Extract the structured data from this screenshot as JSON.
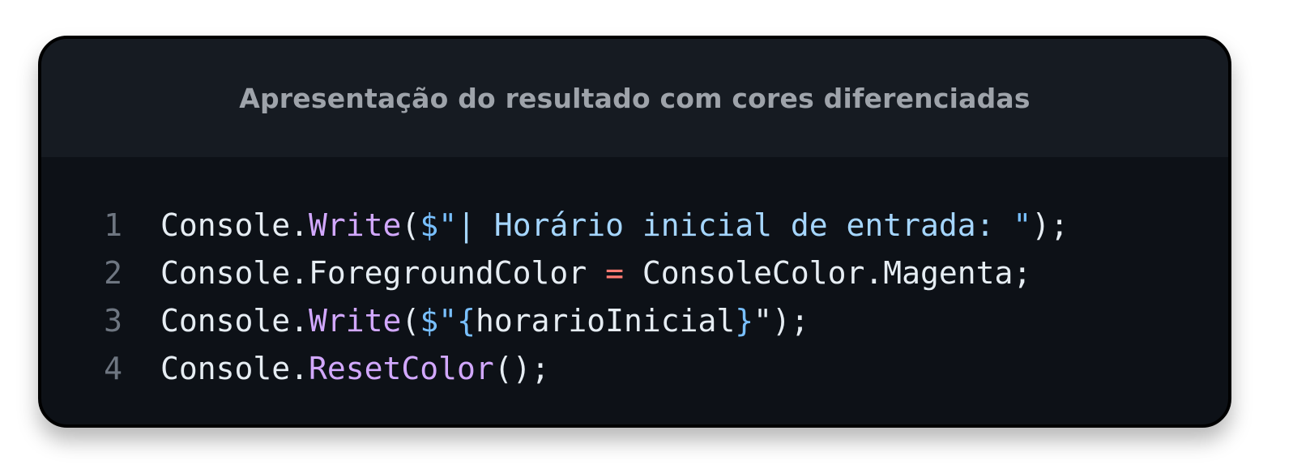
{
  "title": "Apresentação do resultado com cores diferenciadas",
  "colors": {
    "card_background": "#0d1117",
    "header_background": "#161b22",
    "title_text": "#9ea3aa",
    "line_number": "#6e7681",
    "default_text": "#e6edf3",
    "method": "#d2a8ff",
    "string": "#a5d6ff",
    "punctuation": "#79c0ff",
    "operator": "#ff7b72"
  },
  "code": {
    "language": "csharp",
    "lines": [
      {
        "number": "1",
        "tokens": [
          {
            "text": "Console.",
            "kind": "default"
          },
          {
            "text": "Write",
            "kind": "method"
          },
          {
            "text": "(",
            "kind": "default"
          },
          {
            "text": "$\"",
            "kind": "punct"
          },
          {
            "text": "| Horário inicial de entrada: ",
            "kind": "string"
          },
          {
            "text": "\"",
            "kind": "punct"
          },
          {
            "text": ");",
            "kind": "default"
          }
        ]
      },
      {
        "number": "2",
        "tokens": [
          {
            "text": "Console.ForegroundColor ",
            "kind": "default"
          },
          {
            "text": "=",
            "kind": "op"
          },
          {
            "text": " ConsoleColor.Magenta;",
            "kind": "default"
          }
        ]
      },
      {
        "number": "3",
        "tokens": [
          {
            "text": "Console.",
            "kind": "default"
          },
          {
            "text": "Write",
            "kind": "method"
          },
          {
            "text": "(",
            "kind": "default"
          },
          {
            "text": "$\"",
            "kind": "punct"
          },
          {
            "text": "{",
            "kind": "punct"
          },
          {
            "text": "horarioInicial",
            "kind": "default"
          },
          {
            "text": "}",
            "kind": "punct"
          },
          {
            "text": "\"",
            "kind": "default"
          },
          {
            "text": ");",
            "kind": "default"
          }
        ]
      },
      {
        "number": "4",
        "tokens": [
          {
            "text": "Console.",
            "kind": "default"
          },
          {
            "text": "ResetColor",
            "kind": "method"
          },
          {
            "text": "();",
            "kind": "default"
          }
        ]
      }
    ]
  }
}
